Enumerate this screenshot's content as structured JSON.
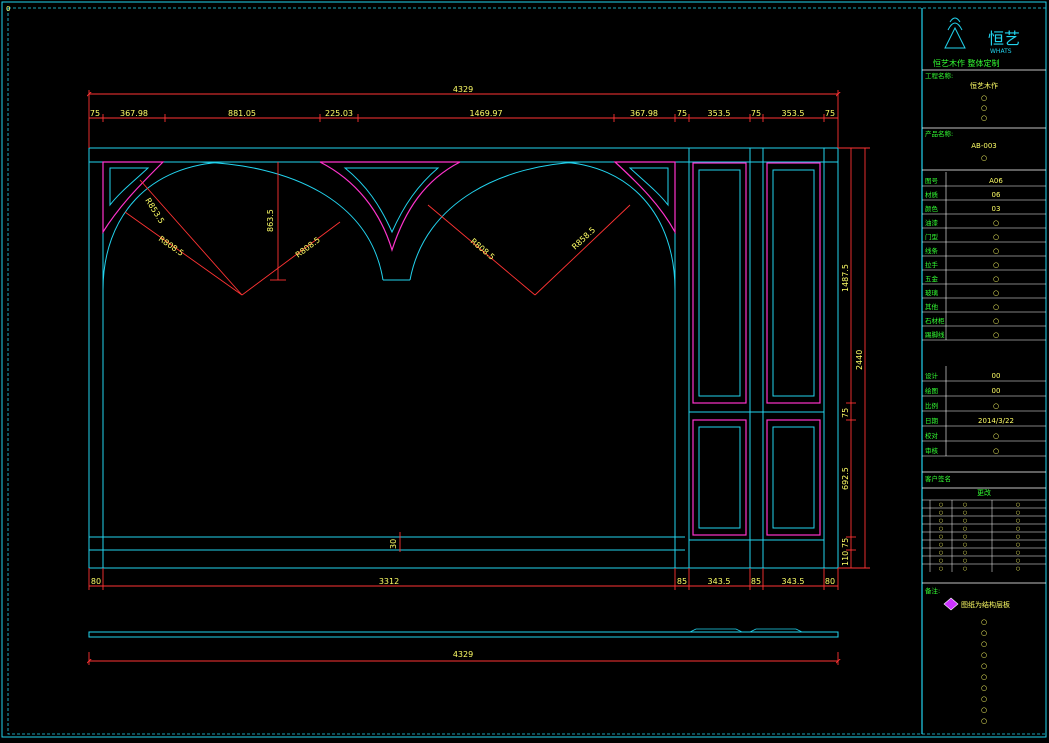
{
  "drawing": {
    "corner_tag": "0",
    "dims_top": [
      "4329",
      "75",
      "367.98",
      "881.05",
      "225.03",
      "1469.97",
      "367.98",
      "75",
      "353.5",
      "75",
      "353.5",
      "75"
    ],
    "dims_bottom": [
      "80",
      "3312",
      "85",
      "343.5",
      "85",
      "343.5",
      "80"
    ],
    "dims_right": [
      "1487.5",
      "2440",
      "75",
      "692.5",
      "110",
      "75"
    ],
    "dims_inner": [
      "863.5",
      "30"
    ],
    "radii": [
      "R853.5",
      "R808.5",
      "R808.5",
      "R808.5",
      "R858.5"
    ],
    "plan_total": "4329"
  },
  "title_block": {
    "logo_text": "恒艺",
    "logo_sub": "WHATS",
    "company": "恒艺木作 整体定制",
    "project_label": "工程名称:",
    "project_value": "恒艺木作",
    "drawing_label": "产品名称:",
    "drawing_value": "AB-003",
    "rows": [
      {
        "label": "图号",
        "value": "A06"
      },
      {
        "label": "材质",
        "value": "06"
      },
      {
        "label": "颜色",
        "value": "03"
      },
      {
        "label": "油漆",
        "value": "○"
      },
      {
        "label": "门型",
        "value": "○"
      },
      {
        "label": "线条",
        "value": "○"
      },
      {
        "label": "拉手",
        "value": "○"
      },
      {
        "label": "五金",
        "value": "○"
      },
      {
        "label": "玻璃",
        "value": "○"
      },
      {
        "label": "其他",
        "value": "○"
      },
      {
        "label": "石材柜",
        "value": "○"
      },
      {
        "label": "踢脚线",
        "value": "○"
      }
    ],
    "rows2": [
      {
        "label": "设计",
        "value": "00"
      },
      {
        "label": "绘图",
        "value": "00"
      },
      {
        "label": "比例",
        "value": "○"
      },
      {
        "label": "日期",
        "value": "2014/3/22"
      },
      {
        "label": "校对",
        "value": "○"
      },
      {
        "label": "审核",
        "value": "○"
      }
    ],
    "client_sign": "客户签名",
    "table_header": "更改",
    "table_rows": 9,
    "remark_label": "备注:",
    "remark_note": "图纸为结构层板",
    "bullets": [
      "○",
      "○",
      "○",
      "○",
      "○",
      "○",
      "○",
      "○",
      "○",
      "○"
    ]
  }
}
